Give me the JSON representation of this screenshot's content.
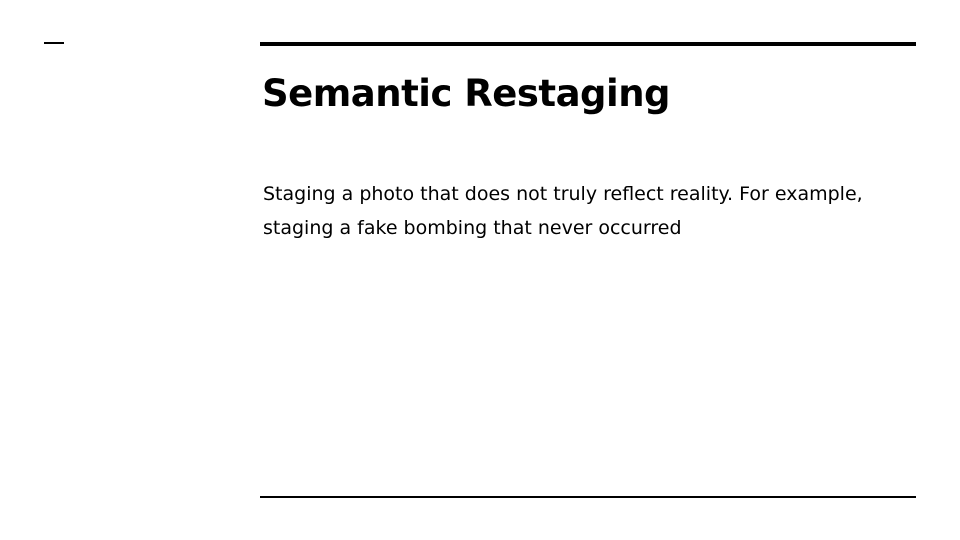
{
  "slide": {
    "title": "Semantic Restaging",
    "body": "Staging a photo that does not truly reflect reality. For example, staging a fake bombing that never occurred"
  }
}
